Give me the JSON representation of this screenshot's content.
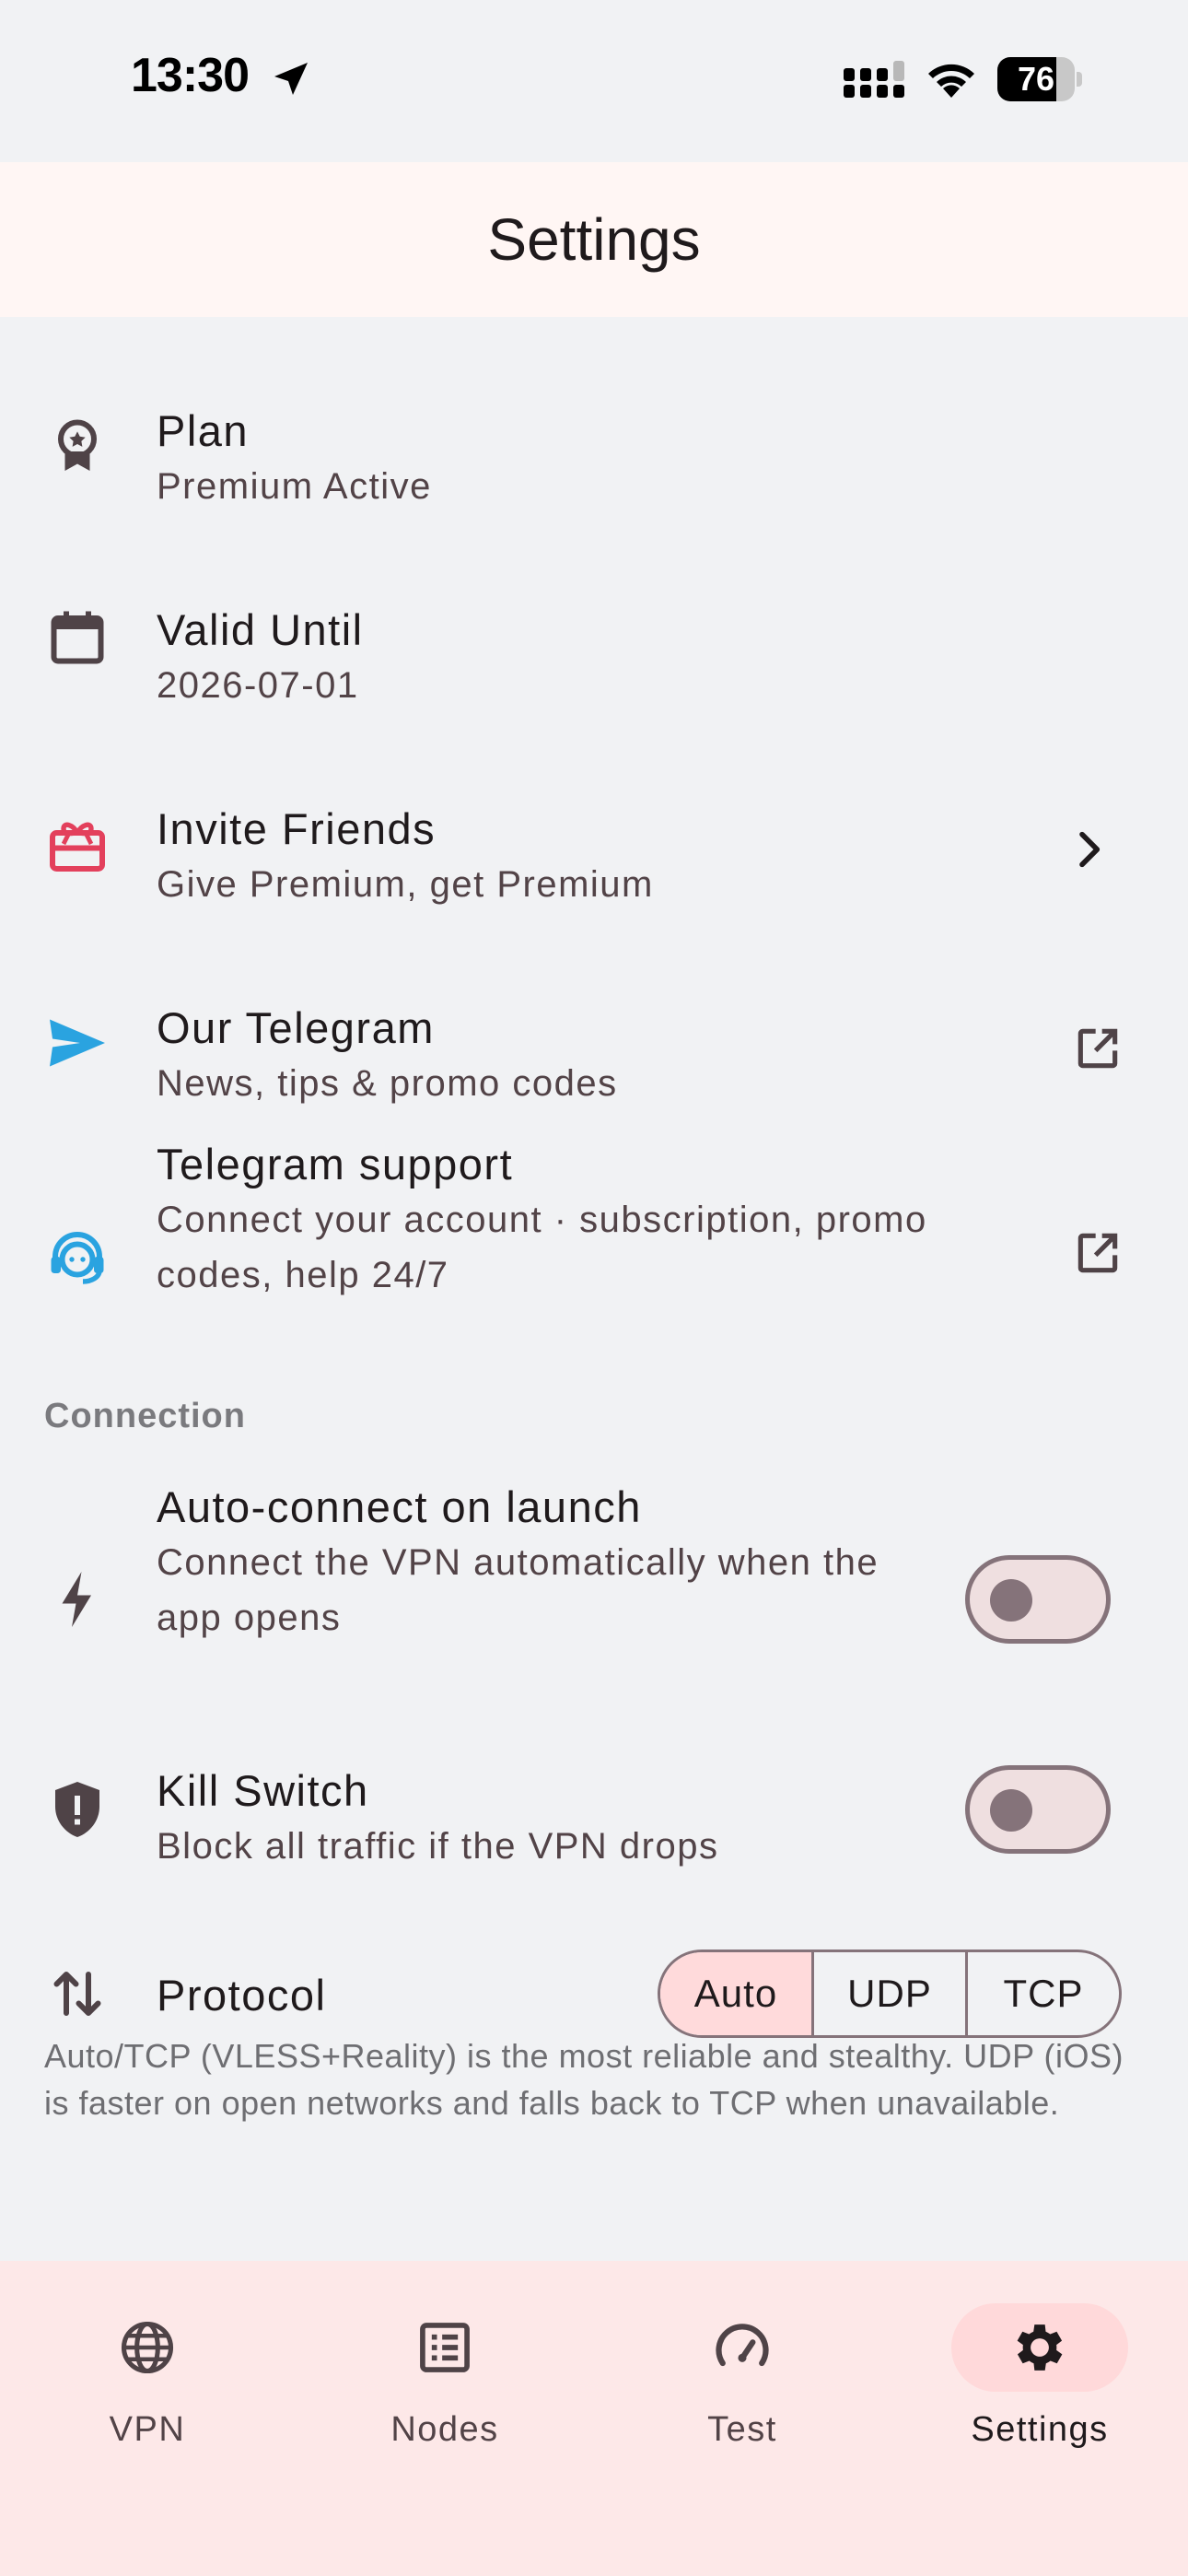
{
  "status_bar": {
    "time": "13:30",
    "battery_percent": 76,
    "battery_text": "76"
  },
  "app_bar": {
    "title": "Settings"
  },
  "account": {
    "plan": {
      "title": "Plan",
      "subtitle": "Premium Active",
      "icon": "award-icon"
    },
    "valid_until": {
      "title": "Valid Until",
      "subtitle": "2026-07-01",
      "icon": "calendar-icon"
    },
    "invite": {
      "title": "Invite Friends",
      "subtitle": "Give Premium, get Premium",
      "icon": "gift-icon"
    },
    "telegram": {
      "title": "Our Telegram",
      "subtitle": "News, tips & promo codes",
      "icon": "send-icon"
    },
    "support": {
      "title": "Telegram support",
      "subtitle": "Connect your account · subscription, promo codes, help 24/7",
      "icon": "support-agent-icon"
    }
  },
  "connection": {
    "header": "Connection",
    "auto_connect": {
      "title": "Auto-connect on launch",
      "subtitle": "Connect the VPN automatically when the app opens",
      "enabled": false
    },
    "kill_switch": {
      "title": "Kill Switch",
      "subtitle": "Block all traffic if the VPN drops",
      "enabled": false
    },
    "protocol": {
      "title": "Protocol",
      "options": [
        "Auto",
        "UDP",
        "TCP"
      ],
      "selected": "Auto",
      "note": "Auto/TCP (VLESS+Reality) is the most reliable and stealthy. UDP (iOS) is faster on open networks and falls back to TCP when unavailable."
    }
  },
  "colors": {
    "accent_red": "#e3405c",
    "telegram_blue": "#2aa3e0",
    "selected_segment": "#ffdadb",
    "nav_background": "#fde8e8"
  },
  "bottom_nav": {
    "items": [
      {
        "label": "VPN",
        "icon": "globe-icon",
        "active": false
      },
      {
        "label": "Nodes",
        "icon": "list-icon",
        "active": false
      },
      {
        "label": "Test",
        "icon": "speedometer-icon",
        "active": false
      },
      {
        "label": "Settings",
        "icon": "gear-icon",
        "active": true
      }
    ]
  }
}
